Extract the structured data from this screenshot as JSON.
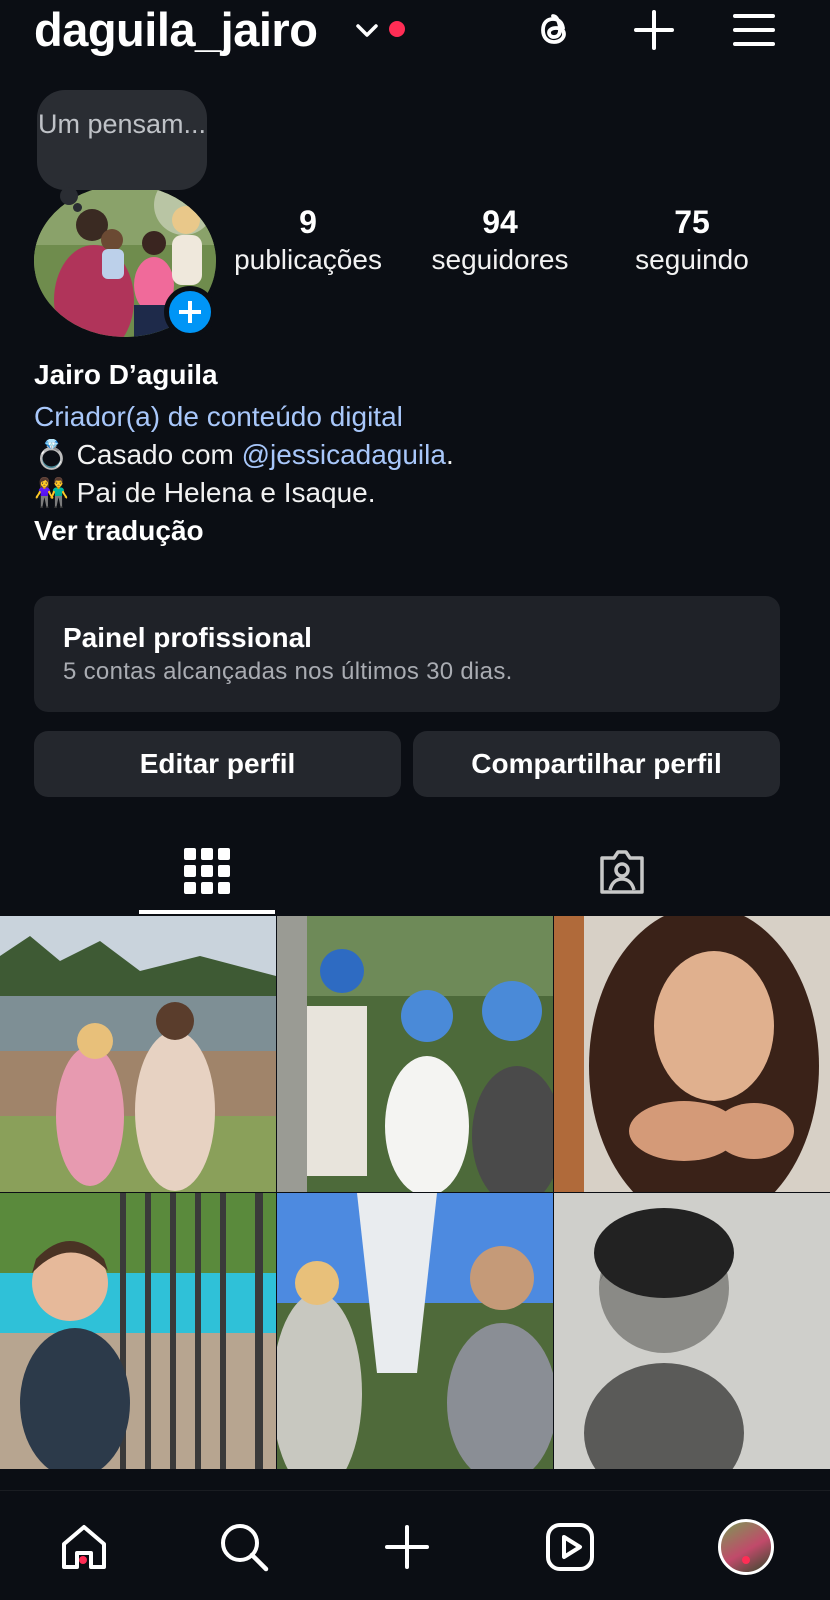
{
  "header": {
    "username": "daguila_jairo",
    "icons": [
      "chevron-down-icon",
      "threads-icon",
      "plus-icon",
      "hamburger-menu-icon"
    ]
  },
  "profile": {
    "note": "Um pensam...",
    "stats": [
      {
        "value": "9",
        "label": "publicações"
      },
      {
        "value": "94",
        "label": "seguidores"
      },
      {
        "value": "75",
        "label": "seguindo"
      }
    ]
  },
  "bio": {
    "name": "Jairo D’aguila",
    "category": "Criador(a) de conteúdo digital",
    "line1_emoji": "💍",
    "line1_text": "Casado com ",
    "line1_mention": "@jessicadaguila",
    "line1_end": ".",
    "line2_emoji": "👫",
    "line2_text": "Pai de Helena e Isaque.",
    "translate": "Ver tradução"
  },
  "panel": {
    "title": "Painel profissional",
    "subtitle": "5 contas alcançadas nos últimos 30 dias."
  },
  "buttons": {
    "edit": "Editar perfil",
    "share": "Compartilhar perfil"
  },
  "tabs": [
    "grid-icon",
    "tagged-icon"
  ],
  "posts": [
    "post-couple-lake",
    "post-family-helmets",
    "post-girl-heart-hands",
    "post-boy-pool-railing",
    "post-couple-statue",
    "post-boy-profile-bw"
  ],
  "bottom_nav": [
    "home-icon",
    "search-icon",
    "create-icon",
    "reels-icon",
    "profile-avatar"
  ],
  "colors": {
    "background": "#0b0e14",
    "accent_blue": "#0095f6",
    "link_blue": "#a8c7fa",
    "notification_red": "#ff2d55",
    "card": "#1f2228"
  }
}
